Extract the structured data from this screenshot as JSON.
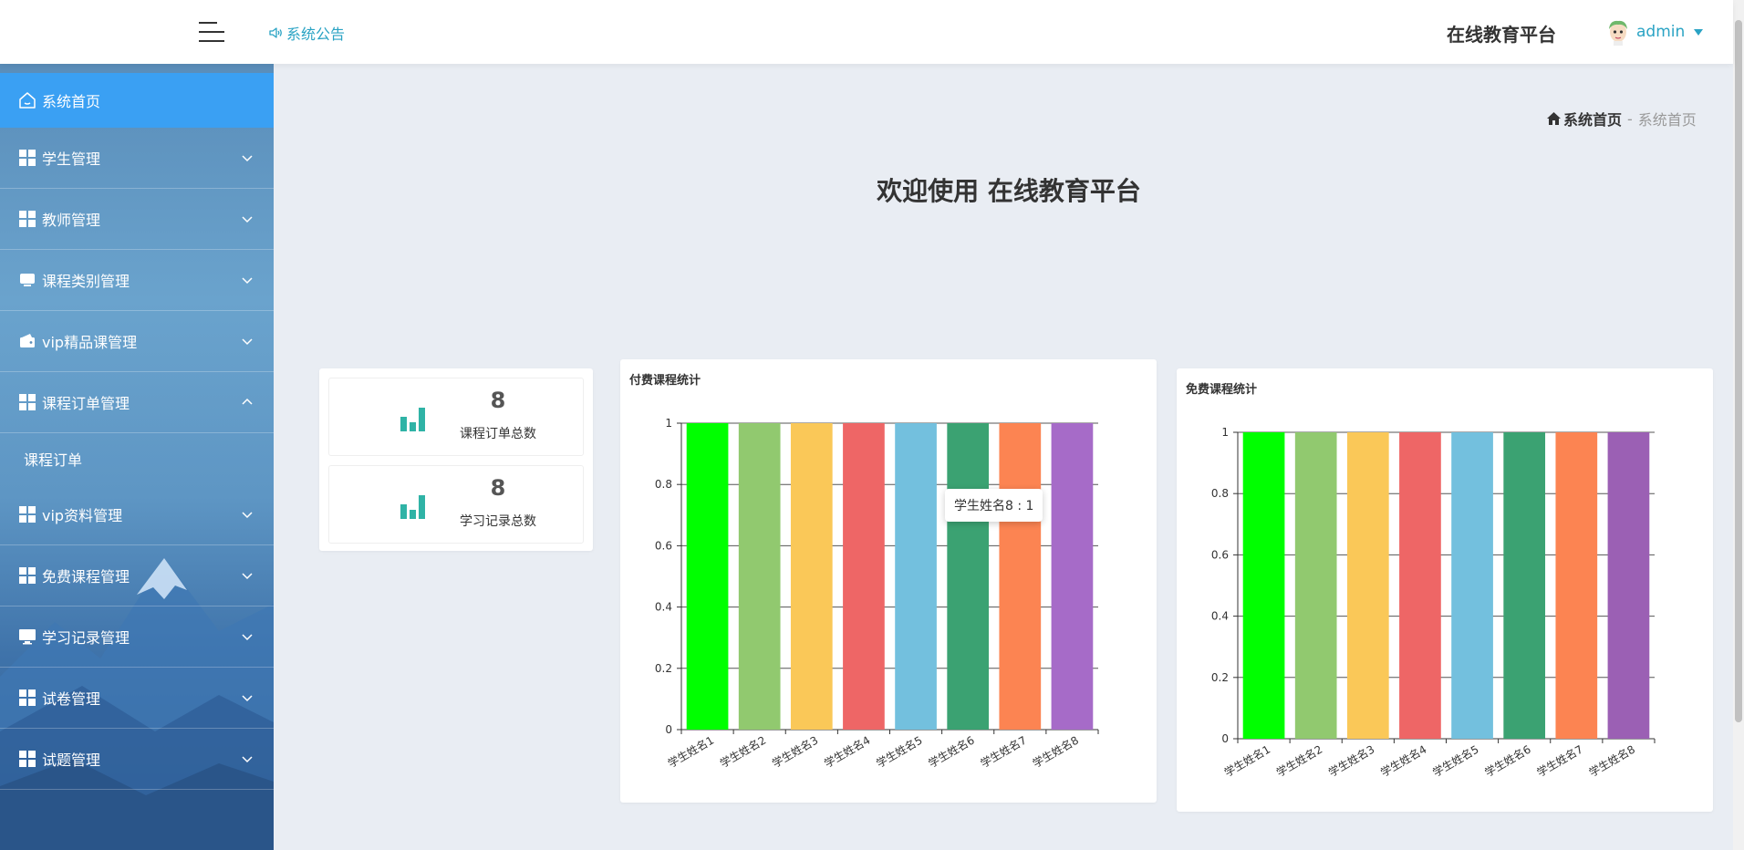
{
  "header": {
    "notice_label": "系统公告",
    "brand": "在线教育平台",
    "user_name": "admin"
  },
  "sidebar": {
    "items": [
      {
        "label": "系统首页",
        "icon": "home-icon",
        "active": true
      },
      {
        "label": "学生管理",
        "icon": "grid-icon"
      },
      {
        "label": "教师管理",
        "icon": "grid-icon"
      },
      {
        "label": "课程类别管理",
        "icon": "tablet-icon"
      },
      {
        "label": "vip精品课管理",
        "icon": "wallet-icon"
      },
      {
        "label": "课程订单管理",
        "icon": "grid-icon",
        "expanded": true
      },
      {
        "label": "vip资料管理",
        "icon": "grid-icon"
      },
      {
        "label": "免费课程管理",
        "icon": "grid-icon"
      },
      {
        "label": "学习记录管理",
        "icon": "monitor-icon"
      },
      {
        "label": "试卷管理",
        "icon": "grid-icon"
      },
      {
        "label": "试题管理",
        "icon": "grid-icon"
      }
    ],
    "sub_item": "课程订单"
  },
  "breadcrumb": {
    "home": "系统首页",
    "separator": "-",
    "current": "系统首页"
  },
  "welcome": {
    "prefix": "欢迎使用",
    "name": "在线教育平台"
  },
  "stats": [
    {
      "value": "8",
      "label": "课程订单总数"
    },
    {
      "value": "8",
      "label": "学习记录总数"
    }
  ],
  "colors": {
    "accent": "#3aa0f3",
    "link": "#2aa3c4",
    "stat_icon": "#2fb3a6"
  },
  "chart_data": [
    {
      "type": "bar",
      "title": "付费课程统计",
      "categories": [
        "学生姓名1",
        "学生姓名2",
        "学生姓名3",
        "学生姓名4",
        "学生姓名5",
        "学生姓名6",
        "学生姓名7",
        "学生姓名8"
      ],
      "values": [
        1,
        1,
        1,
        1,
        1,
        1,
        1,
        1
      ],
      "colors": [
        "#00ff00",
        "#91c96f",
        "#fac858",
        "#ee6666",
        "#73c0de",
        "#3ba272",
        "#fc8452",
        "#a66bc8"
      ],
      "ylim": [
        0,
        1
      ],
      "yticks": [
        "0",
        "0.2",
        "0.4",
        "0.6",
        "0.8",
        "1"
      ],
      "grid": true,
      "tooltip": "学生姓名8 : 1"
    },
    {
      "type": "bar",
      "title": "免费课程统计",
      "categories": [
        "学生姓名1",
        "学生姓名2",
        "学生姓名3",
        "学生姓名4",
        "学生姓名5",
        "学生姓名6",
        "学生姓名7",
        "学生姓名8"
      ],
      "values": [
        1,
        1,
        1,
        1,
        1,
        1,
        1,
        1
      ],
      "colors": [
        "#00ff00",
        "#91c96f",
        "#fac858",
        "#ee6666",
        "#73c0de",
        "#3ba272",
        "#fc8452",
        "#9b60b4"
      ],
      "ylim": [
        0,
        1
      ],
      "yticks": [
        "0",
        "0.2",
        "0.4",
        "0.6",
        "0.8",
        "1"
      ],
      "grid": true
    }
  ]
}
